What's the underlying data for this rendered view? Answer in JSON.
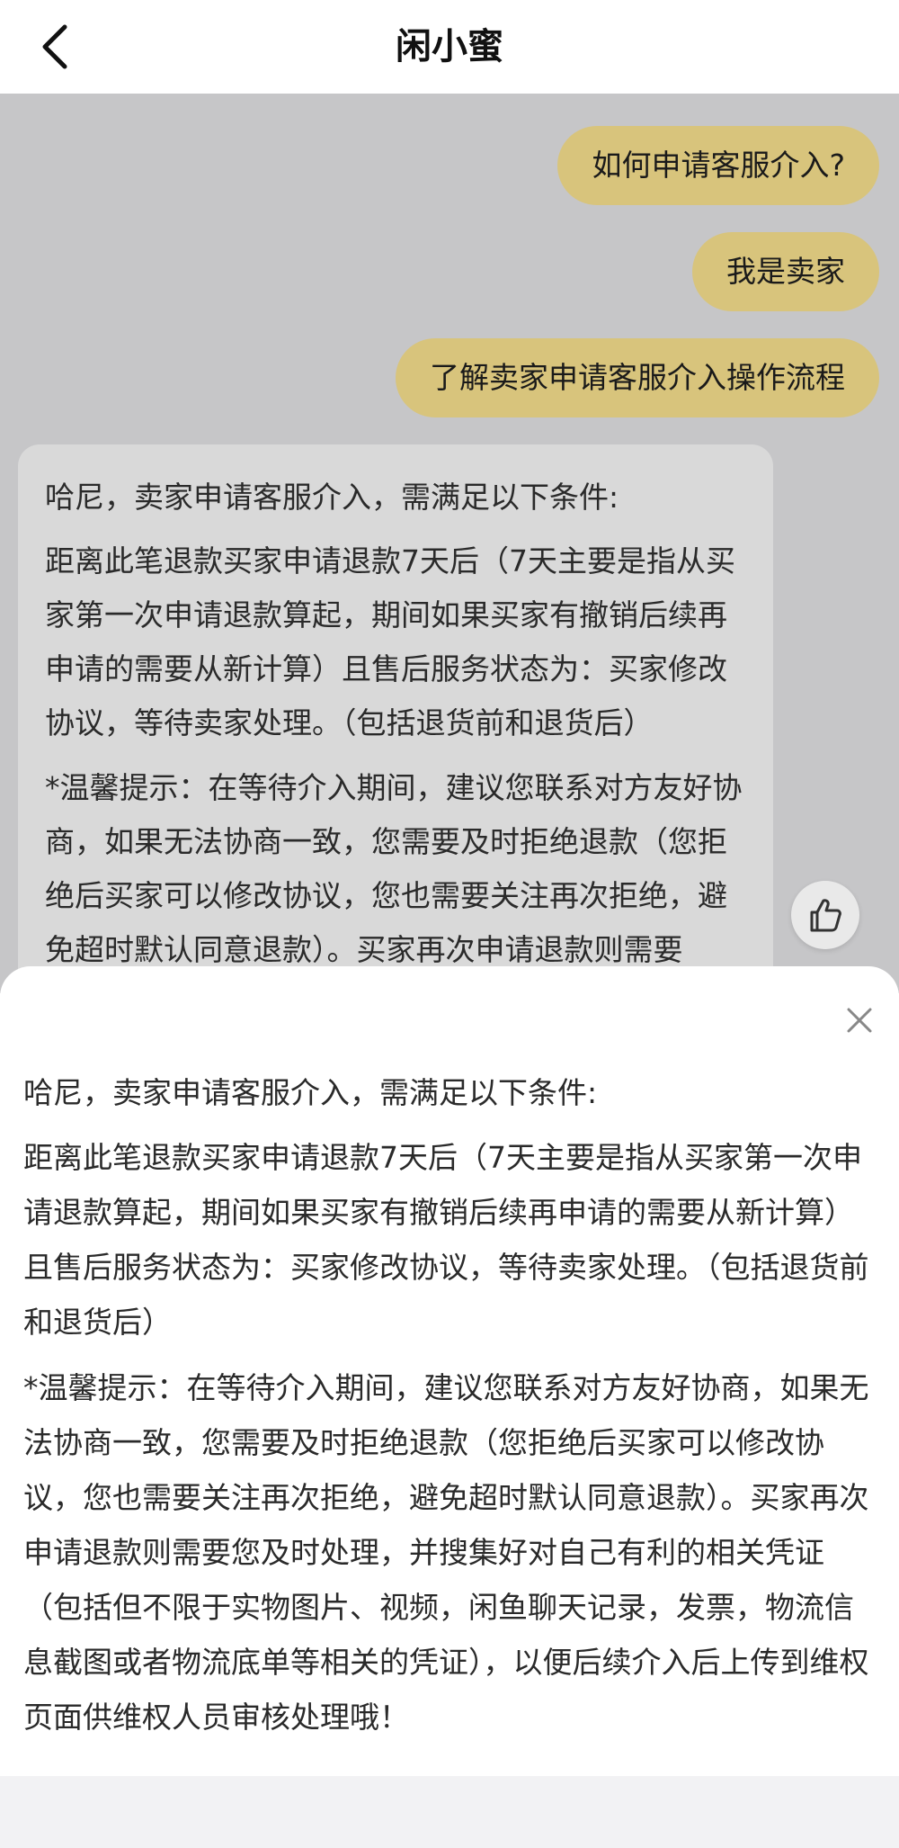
{
  "header": {
    "title": "闲小蜜",
    "back_icon": "chevron-left-icon"
  },
  "chat": {
    "user_messages": [
      "如何申请客服介入?",
      "我是卖家",
      "了解卖家申请客服介入操作流程"
    ],
    "bot_message": {
      "intro": "哈尼，卖家申请客服介入，需满足以下条件:",
      "paragraph1": "距离此笔退款买家申请退款7天后（7天主要是指从买家第一次申请退款算起，期间如果买家有撤销后续再申请的需要从新计算）且售后服务状态为：买家修改协议，等待卖家处理。（包括退货前和退货后）",
      "paragraph2": "*温馨提示：在等待介入期间，建议您联系对方友好协商，如果无法协商一致，您需要及时拒绝退款（您拒绝后买家可以修改协议，您也需要关注再次拒绝，避免超时默认同意退款）。买家再次申请退款则需要"
    },
    "like_icon": "thumbs-up-icon"
  },
  "sheet": {
    "close_icon": "close-icon",
    "intro": "哈尼，卖家申请客服介入，需满足以下条件:",
    "paragraph1": "距离此笔退款买家申请退款7天后（7天主要是指从买家第一次申请退款算起，期间如果买家有撤销后续再申请的需要从新计算）且售后服务状态为：买家修改协议，等待卖家处理。（包括退货前和退货后）",
    "paragraph2": "*温馨提示：在等待介入期间，建议您联系对方友好协商，如果无法协商一致，您需要及时拒绝退款（您拒绝后买家可以修改协议，您也需要关注再次拒绝，避免超时默认同意退款）。买家再次申请退款则需要您及时处理，并搜集好对自己有利的相关凭证（包括但不限于实物图片、视频，闲鱼聊天记录，发票，物流信息截图或者物流底单等相关的凭证），以便后续介入后上传到维权页面供维权人员审核处理哦！"
  },
  "colors": {
    "user_bubble": "#d8c47c",
    "chat_background_dimmed": "#c6c6c8",
    "bot_bubble_dimmed": "#d9d9d9"
  }
}
